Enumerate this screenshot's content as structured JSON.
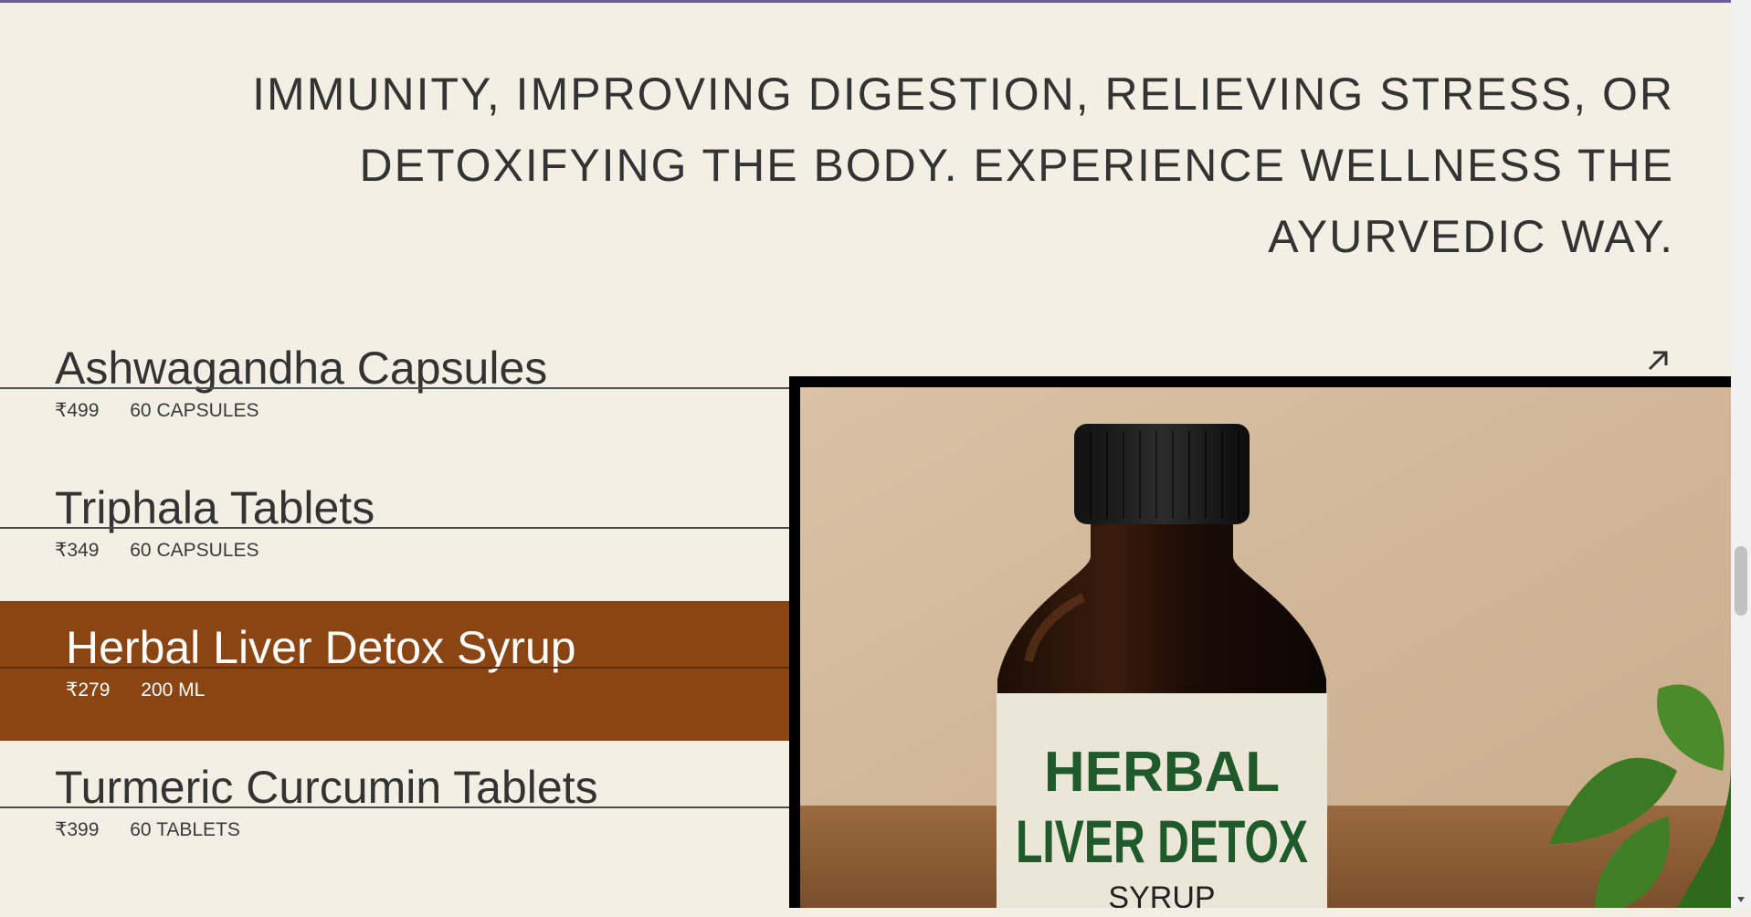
{
  "intro": {
    "text": "IMMUNITY, IMPROVING DIGESTION, RELIEVING STRESS, OR DETOXIFYING THE BODY. EXPERIENCE WELLNESS THE AYURVEDIC WAY."
  },
  "products": [
    {
      "name": "Ashwagandha Capsules",
      "price": "₹499",
      "size": "60 CAPSULES"
    },
    {
      "name": "Triphala Tablets",
      "price": "₹349",
      "size": "60 CAPSULES"
    },
    {
      "name": "Herbal Liver Detox Syrup",
      "price": "₹279",
      "size": "200 ML"
    },
    {
      "name": "Turmeric Curcumin Tablets",
      "price": "₹399",
      "size": "60 TABLETS"
    }
  ],
  "active_index": 2,
  "preview": {
    "label_line1": "HERBAL",
    "label_line2": "LIVER DETOX",
    "label_line3": "SYRUP"
  },
  "icons": {
    "open_link": "arrow-up-right-icon"
  },
  "colors": {
    "background": "#f3efe5",
    "active_row": "#8b4513",
    "text": "#333333",
    "label_green": "#1f5a2a"
  }
}
